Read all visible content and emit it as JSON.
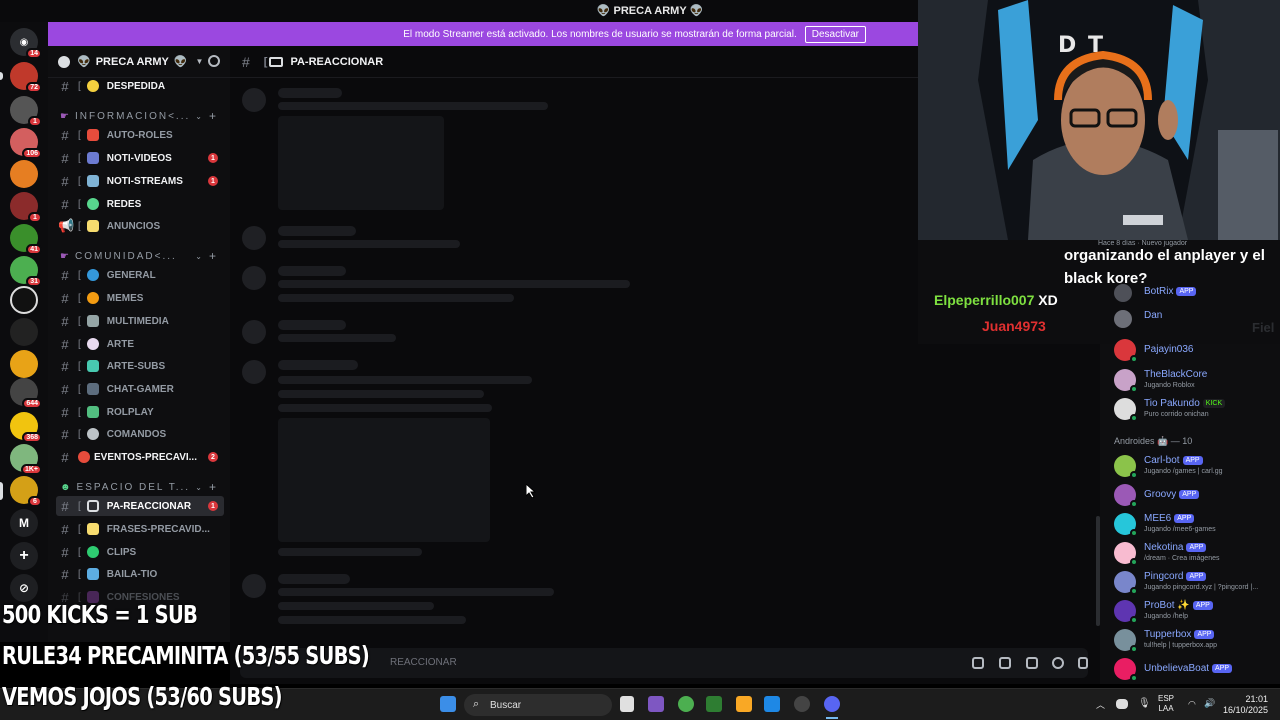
{
  "window": {
    "title": "PRECA ARMY"
  },
  "banner": {
    "text": "El modo Streamer está activado. Los nombres de usuario se mostrarán de forma parcial.",
    "button": "Desactivar"
  },
  "rail_badges": [
    "14",
    "72",
    "1",
    "106",
    "1",
    "41",
    "31",
    "644",
    "368",
    "1K+",
    "6"
  ],
  "rail_letter": "M",
  "server": {
    "name": "PRECA ARMY"
  },
  "channels": {
    "despedida": "DESPEDIDA",
    "cat_info": "INFORMACION<...",
    "auto_roles": "AUTO-ROLES",
    "noti_videos": "NOTI-VIDEOS",
    "noti_streams": "NOTI-STREAMS",
    "redes": "REDES",
    "anuncios": "ANUNCIOS",
    "cat_comunidad": "COMUNIDAD<...",
    "general": "GENERAL",
    "memes": "MEMES",
    "multimedia": "MULTIMEDIA",
    "arte": "ARTE",
    "arte_subs": "ARTE-SUBS",
    "chat_gamer": "CHAT-GAMER",
    "rolplay": "ROLPLAY",
    "comandos": "COMANDOS",
    "eventos": "EVENTOS-PRECAVI...",
    "cat_espacio": "ESPACIO DEL T...",
    "pa_reaccionar": "PA-REACCIONAR",
    "frases": "FRASES-PRECAVID...",
    "clips": "CLIPS",
    "baila_tio": "BAILA-TIO",
    "confesiones": "CONFESIONES",
    "unread_count": "1",
    "eventos_count": "2"
  },
  "chat": {
    "channel": "PA-REACCIONAR",
    "placeholder": "REACCIONAR"
  },
  "overlay": {
    "meta": "Hace 8 días · Nuevo jugador",
    "message": "organizando el anplayer y el black kore?",
    "user1": "Elpeperrillo007",
    "user1_msg": "XD",
    "user2": "Juan4973",
    "faded": "Fiel"
  },
  "members": {
    "botrix": {
      "name": "BotRix",
      "tag": "APP"
    },
    "dan": {
      "name": "Dan"
    },
    "pajayin": {
      "name": "Pajayin036"
    },
    "blackcore": {
      "name": "TheBlackCore",
      "status": "Jugando Roblox"
    },
    "pakundo": {
      "name": "Tio Pakundo",
      "tag": "KICK",
      "status": "Puro corrido onichan"
    },
    "group": "Androides",
    "group_count": "— 10",
    "carlbot": {
      "name": "Carl-bot",
      "tag": "APP",
      "status": "Jugando /games | carl.gg"
    },
    "groovy": {
      "name": "Groovy",
      "tag": "APP"
    },
    "mee6": {
      "name": "MEE6",
      "tag": "APP",
      "status": "Jugando /mee6-games"
    },
    "nekotina": {
      "name": "Nekotina",
      "tag": "APP",
      "status": "/dream · Crea imágenes"
    },
    "pingcord": {
      "name": "Pingcord",
      "tag": "APP",
      "status": "Jugando pingcord.xyz | ?pingcord |..."
    },
    "probot": {
      "name": "ProBot",
      "tag": "APP",
      "status": "Jugando /help"
    },
    "tupperbox": {
      "name": "Tupperbox",
      "tag": "APP",
      "status": "tul!help | tupperbox.app"
    },
    "unbelievaboat": {
      "name": "UnbelievaBoat",
      "tag": "APP"
    }
  },
  "stream_goals": [
    "500 KICKS = 1 SUB",
    "RULE34 PRECAMINITA (53/55 SUBS)",
    "VEMOS JOJOS (53/60 SUBS)"
  ],
  "taskbar": {
    "search": "Buscar",
    "lang1": "ESP",
    "lang2": "LAA",
    "time": "21:01",
    "date": "16/10/2025"
  },
  "colors": {
    "banner": "#9b48e0",
    "unread": "#da373c",
    "app_tag": "#5865f2",
    "overlay_user1": "#7ee040",
    "overlay_user2": "#e03030"
  }
}
